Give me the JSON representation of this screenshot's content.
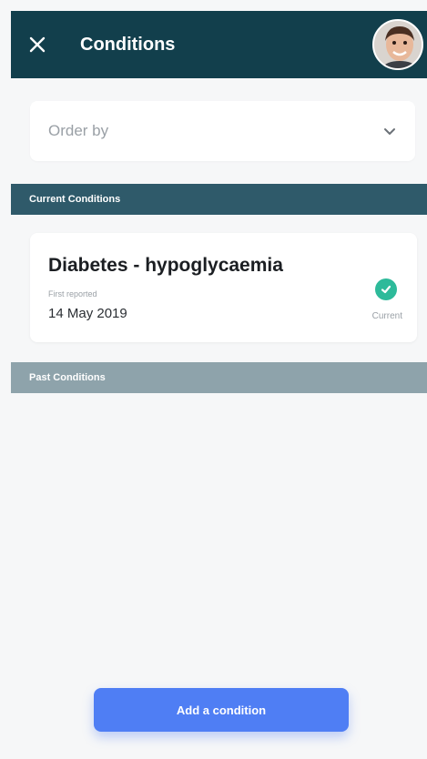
{
  "header": {
    "title": "Conditions",
    "close_icon": "close-icon",
    "avatar_icon": "user-avatar"
  },
  "order_select": {
    "placeholder": "Order by",
    "icon": "chevron-down-icon"
  },
  "sections": {
    "current_label": "Current Conditions",
    "past_label": "Past Conditions"
  },
  "conditions": [
    {
      "name": "Diabetes - hypoglycaemia",
      "first_reported_label": "First reported",
      "date": "14 May 2019",
      "status": "Current",
      "status_icon": "check-circle-icon"
    }
  ],
  "actions": {
    "add_condition": "Add a condition"
  },
  "colors": {
    "header_bg": "#123f4c",
    "current_bar": "#2f5a6a",
    "past_bar": "#8ea3ab",
    "accent": "#4f7ef4",
    "status_green": "#2dba9a"
  }
}
